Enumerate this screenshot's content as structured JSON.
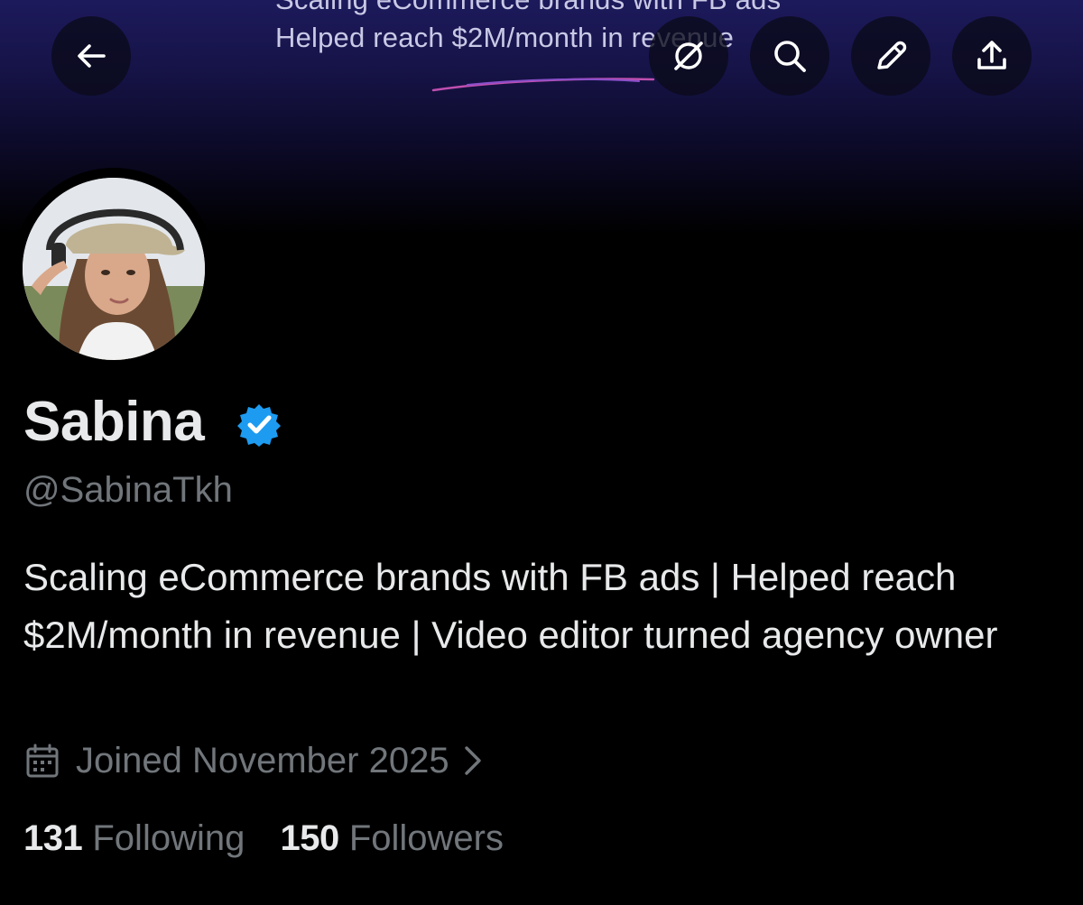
{
  "banner": {
    "line1": "Scaling eCommerce brands with FB ads",
    "line2": "Helped reach $2M/month in revenue"
  },
  "toolbar": {
    "icons": [
      "back-arrow-icon",
      "grok-icon",
      "search-icon",
      "pencil-icon",
      "share-icon"
    ]
  },
  "profile": {
    "name": "Sabina",
    "handle": "@SabinaTkh",
    "bio": "Scaling eCommerce brands with FB ads | Helped reach $2M/month in revenue | Video editor turned agency owner",
    "joined": "Joined November 2025",
    "following_count": "131",
    "following_label": "Following",
    "followers_count": "150",
    "followers_label": "Followers"
  },
  "colors": {
    "background": "#000000",
    "text_primary": "#e7e9ea",
    "text_secondary": "#71767b",
    "verified_badge": "#1d9bf0",
    "banner_top": "#1d1a5c"
  }
}
